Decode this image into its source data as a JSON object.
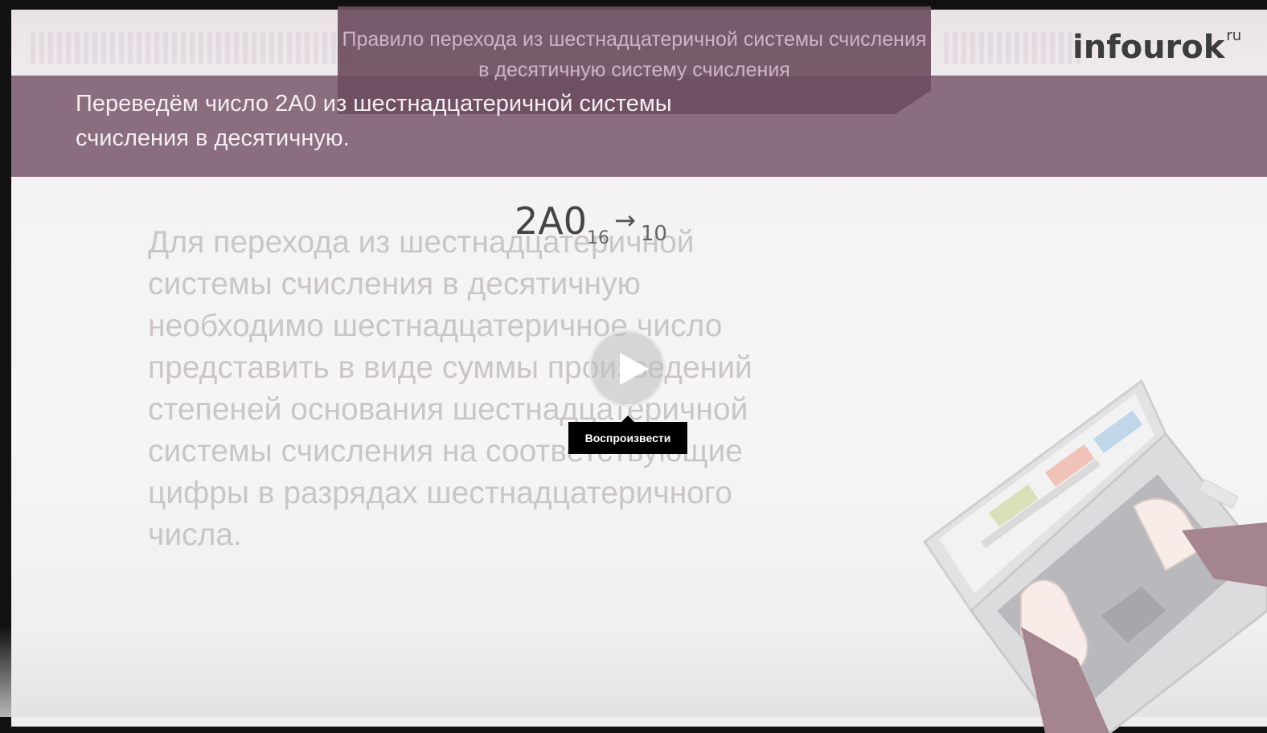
{
  "slide": {
    "header_title": "Правило перехода из шестнадцатеричной системы счисления в десятичную систему счисления",
    "band_text": "Переведём число 2A0 из шестнадцатеричной системы счисления в десятичную.",
    "logo": {
      "text": "infourok",
      "superscript": "ru"
    },
    "formula": {
      "number": "2A0",
      "from_base": "16",
      "arrow": "→",
      "to_base": "10"
    },
    "description": "Для перехода из шестнадцатеричной системы счисления в десятичную необходимо шестнадцатеричное число представить в виде суммы произведений степеней основания шестнадцатеричной системы счисления на соответствующие цифры в разрядах шестнадцатеричного числа."
  },
  "player": {
    "play_tooltip": "Воспроизвести",
    "play_icon": "play-icon"
  },
  "colors": {
    "band": "#8a6d7e",
    "title_card": "#6c4e60",
    "background": "#f4f3f4"
  }
}
